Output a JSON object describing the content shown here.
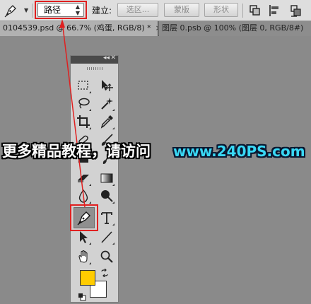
{
  "options_bar": {
    "tool_icon": "pen-icon",
    "mode_value": "路径",
    "create_label": "建立:",
    "selection_button": "选区...",
    "mask_button": "蒙版",
    "shape_button": "形状",
    "path_ops_icon": "path-operations-icon",
    "path_align_icon": "path-alignment-icon",
    "path_arrange_icon": "path-arrangement-icon"
  },
  "tabs": [
    {
      "label": "0104539.psd @ 66.7% (鸡蛋, RGB/8) *",
      "close": "×"
    },
    {
      "label": "图层 0.psb @ 100% (图层 0, RGB/8#)",
      "close": ""
    }
  ],
  "tools_panel": {
    "collapse_icon": "double-chevron-icon",
    "close_icon": "close-icon",
    "active_tool": "pen-tool"
  },
  "colors": {
    "foreground": "#ffcc00",
    "background": "#ffffff",
    "highlight": "#e02020"
  },
  "watermark": {
    "text": "更多精品教程，请访问",
    "url": "www.240PS.com"
  }
}
